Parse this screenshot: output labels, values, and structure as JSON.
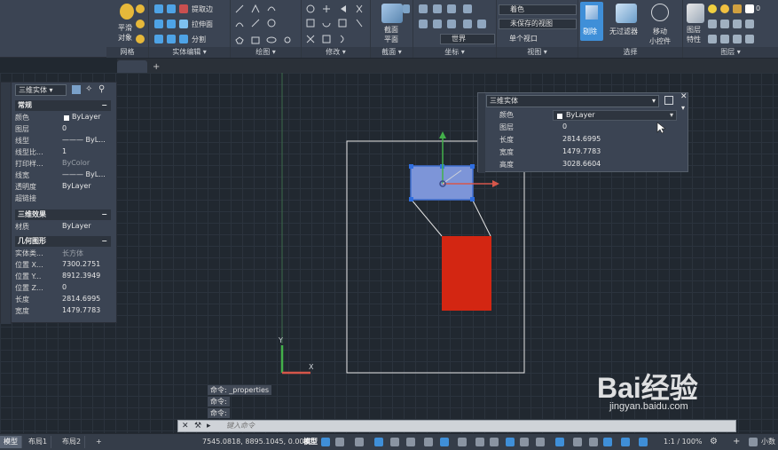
{
  "ribbon": {
    "solid_btn": {
      "line1": "平滑",
      "line2": "对象"
    },
    "solid_edit": {
      "extract_edges": "提取边",
      "extrude_face": "拉伸面",
      "separate": "分割"
    },
    "visual_style": "着色",
    "view_unsaved": "未保存的视图",
    "ucs_world": "世界",
    "viewport": "单个视口",
    "section_plane": {
      "line1": "截面",
      "line2": "平面"
    },
    "cull": "剔除",
    "no_filter": "无过滤器",
    "move_gizmo": {
      "line1": "移动",
      "line2": "小控件"
    },
    "layer_props": {
      "line1": "图层",
      "line2": "特性"
    },
    "layer_value": "0",
    "group_titles": {
      "mesh": "网格",
      "solid_edit": "实体编辑",
      "draw": "绘图",
      "modify": "修改",
      "section": "截面",
      "coordinates": "坐标",
      "view": "视图",
      "selection": "选择",
      "layers": "图层"
    }
  },
  "left_palette": {
    "selector": "三维实体",
    "sections": {
      "general": "常规",
      "3d": "三维效果",
      "geometry": "几何图形"
    },
    "general_rows": [
      {
        "key": "颜色",
        "value": "ByLayer"
      },
      {
        "key": "图层",
        "value": "0"
      },
      {
        "key": "线型",
        "value": "——— ByL..."
      },
      {
        "key": "线型比...",
        "value": "1"
      },
      {
        "key": "打印样...",
        "value": "ByColor"
      },
      {
        "key": "线宽",
        "value": "——— ByL..."
      },
      {
        "key": "透明度",
        "value": "ByLayer"
      },
      {
        "key": "超链接",
        "value": ""
      }
    ],
    "material_row": {
      "key": "材质",
      "value": "ByLayer"
    },
    "geometry_rows": [
      {
        "key": "实体类...",
        "value": "长方体"
      },
      {
        "key": "位置 X...",
        "value": "7300.2751"
      },
      {
        "key": "位置 Y...",
        "value": "8912.3949"
      },
      {
        "key": "位置 Z...",
        "value": "0"
      },
      {
        "key": "长度",
        "value": "2814.6995"
      },
      {
        "key": "宽度",
        "value": "1479.7783"
      }
    ]
  },
  "quick_props": {
    "title": "三维实体",
    "rows": [
      {
        "key": "颜色",
        "value": "ByLayer"
      },
      {
        "key": "图层",
        "value": "0"
      },
      {
        "key": "长度",
        "value": "2814.6995"
      },
      {
        "key": "宽度",
        "value": "1479.7783"
      },
      {
        "key": "高度",
        "value": "3028.6604"
      }
    ]
  },
  "commands": {
    "history": [
      "命令: _properties",
      "命令:",
      "命令:"
    ],
    "input_placeholder": "键入命令"
  },
  "status": {
    "tabs": [
      "模型",
      "布局1",
      "布局2"
    ],
    "coords": "7545.0818, 8895.1045, 0.0000",
    "model_label": "模型",
    "scale": "1:1 / 100%",
    "units": "小数"
  },
  "watermark": {
    "main": "Bai经验",
    "sub": "jingyan.baidu.com"
  },
  "colors": {
    "accent": "#3f8fd8",
    "selection": "#7d95d8",
    "box_red": "#d32612"
  }
}
